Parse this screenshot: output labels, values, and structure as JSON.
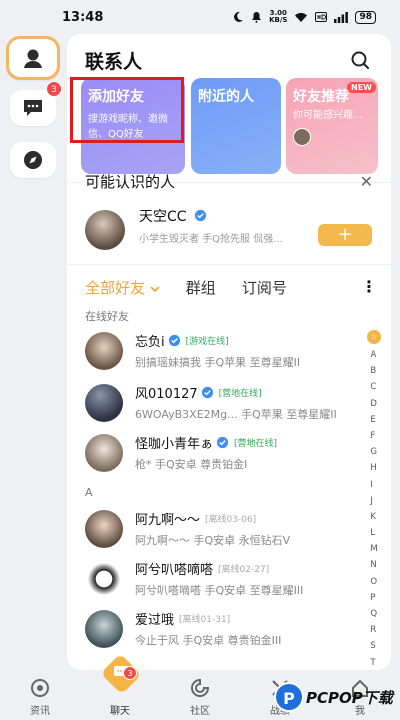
{
  "status_bar": {
    "time": "13:48",
    "net_speed": "3.00",
    "net_unit": "KB/S",
    "battery": "98"
  },
  "rail": {
    "messages_badge": "3"
  },
  "header": {
    "title": "联系人"
  },
  "cards": {
    "add_friend": {
      "title": "添加好友",
      "desc": "搜游戏昵称、邀微信、QQ好友"
    },
    "nearby": {
      "title": "附近的人"
    },
    "recommend": {
      "title": "好友推荐",
      "badge": "NEW",
      "desc": "你可能感兴趣..."
    }
  },
  "may_know": {
    "title": "可能认识的人",
    "person": {
      "name": "天空CC",
      "sub": "小学生毁灭者 手Q抢先服 侃强..."
    },
    "add_label": "+"
  },
  "tabs": {
    "all": "全部好友",
    "groups": "群组",
    "subs": "订阅号",
    "more": "⋮"
  },
  "sections": {
    "online": "在线好友",
    "a": "A"
  },
  "friends_online": [
    {
      "name": "忘负i",
      "status": "[游戏在线]",
      "sub": "别搞瑶妹搞我   手Q苹果   至尊星耀II"
    },
    {
      "name": "风010127",
      "status": "[营地在线]",
      "sub": "6WOAyB3XE2Mg...   手Q苹果   至尊星耀II"
    },
    {
      "name": "怪咖小青年ぁ",
      "status": "[营地在线]",
      "sub": "枪*   手Q安卓   尊贵铂金I"
    }
  ],
  "friends_a": [
    {
      "name": "阿九啊～～",
      "status": "[离线03-06]",
      "sub": "阿九啊～～   手Q安卓   永恒钻石V"
    },
    {
      "name": "阿兮叭嗒嘀嗒",
      "status": "[离线02-27]",
      "sub": "阿兮叭嗒嘀嗒   手Q安卓   至尊星耀III"
    },
    {
      "name": "爱过哦",
      "status": "[离线01-31]",
      "sub": "今止于风   手Q安卓   尊贵铂金III"
    }
  ],
  "alpha_index": {
    "star": "☆",
    "letters": [
      "A",
      "B",
      "C",
      "D",
      "E",
      "F",
      "G",
      "H",
      "I",
      "J",
      "K",
      "L",
      "M",
      "N",
      "O",
      "P",
      "Q",
      "R",
      "S",
      "T"
    ]
  },
  "nav": {
    "news": "资讯",
    "chat": "聊天",
    "chat_badge": "3",
    "community": "社区",
    "battle": "战绩",
    "me": "我"
  },
  "watermark": {
    "logo": "P",
    "text": "PCPOP下载"
  },
  "colors": {
    "accent": "#f2a33a",
    "online": "#2faa58",
    "badge": "#f04a4a",
    "highlight": "#e21b1b"
  }
}
